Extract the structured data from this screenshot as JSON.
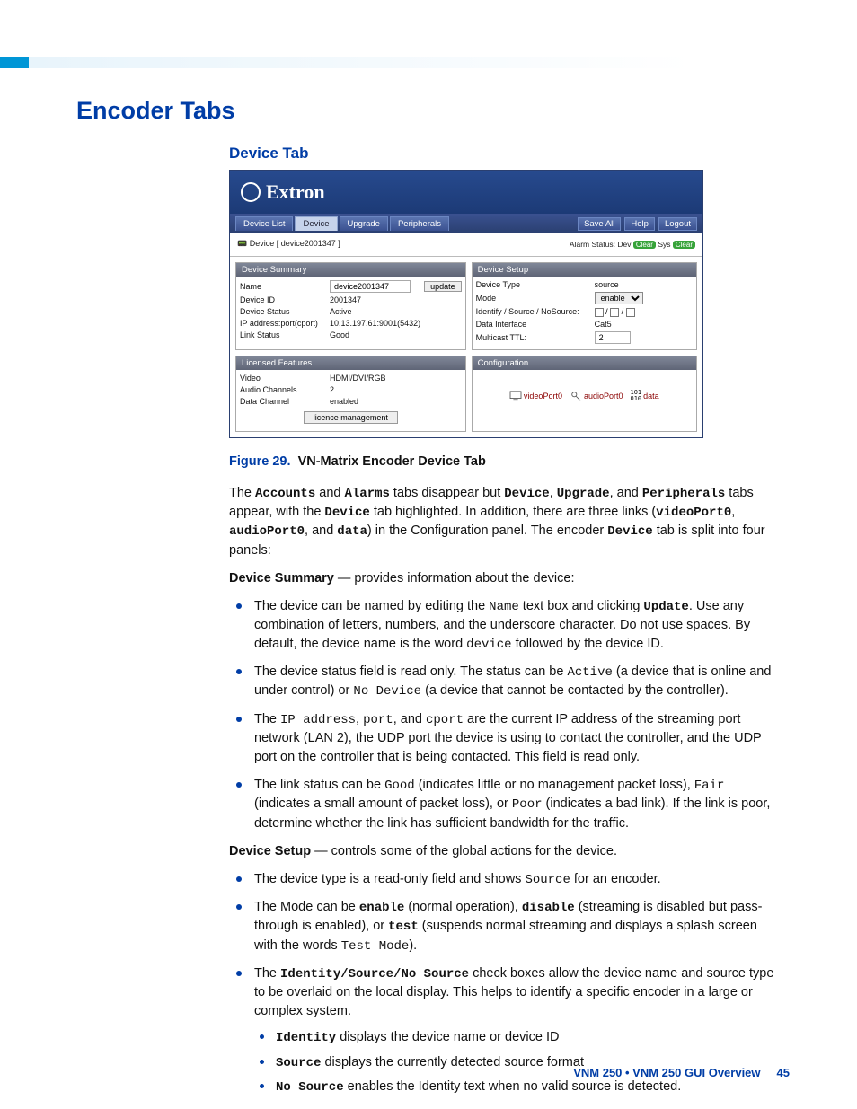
{
  "headings": {
    "section": "Encoder Tabs",
    "subsection": "Device Tab"
  },
  "screenshot": {
    "brand": "Extron",
    "tabs": {
      "device_list": "Device List",
      "device": "Device",
      "upgrade": "Upgrade",
      "peripherals": "Peripherals"
    },
    "top_buttons": {
      "save_all": "Save All",
      "help": "Help",
      "logout": "Logout"
    },
    "breadcrumb": "Device [ device2001347 ]",
    "alarm": {
      "label": "Alarm Status:",
      "dev": "Dev",
      "sys": "Sys",
      "clear": "Clear"
    },
    "panels": {
      "summary_head": "Device Summary",
      "setup_head": "Device Setup",
      "licensed_head": "Licensed Features",
      "config_head": "Configuration"
    },
    "summary": {
      "name_k": "Name",
      "name_v": "device2001347",
      "update": "update",
      "devid_k": "Device ID",
      "devid_v": "2001347",
      "status_k": "Device Status",
      "status_v": "Active",
      "ip_k": "IP address:port(cport)",
      "ip_v": "10.13.197.61:9001(5432)",
      "link_k": "Link Status",
      "link_v": "Good"
    },
    "setup": {
      "type_k": "Device Type",
      "type_v": "source",
      "mode_k": "Mode",
      "mode_v": "enable",
      "isn_k": "Identify / Source / NoSource:",
      "di_k": "Data Interface",
      "di_v": "Cat5",
      "ttl_k": "Multicast TTL:",
      "ttl_v": "2"
    },
    "licensed": {
      "video_k": "Video",
      "video_v": "HDMI/DVI/RGB",
      "audio_k": "Audio Channels",
      "audio_v": "2",
      "data_k": "Data Channel",
      "data_v": "enabled",
      "lic_btn": "licence management"
    },
    "config_links": {
      "video": "videoPort0",
      "audio": "audioPort0",
      "data": "data",
      "data_icon": "101\n010"
    }
  },
  "figure": {
    "label": "Figure 29.",
    "title": "VN-Matrix Encoder Device Tab"
  },
  "para1": {
    "t1": "The ",
    "accounts": "Accounts",
    "t2": " and ",
    "alarms": "Alarms",
    "t3": " tabs disappear but ",
    "device": "Device",
    "t4": ", ",
    "upgrade": "Upgrade",
    "t5": ", and ",
    "peripherals": "Peripherals",
    "t6": " tabs appear, with the ",
    "device2": "Device",
    "t7": " tab highlighted. In addition, there are three links (",
    "vp": "videoPort0",
    "t8": ", ",
    "ap": "audioPort0",
    "t9": ", and ",
    "data": "data",
    "t10": ") in the Configuration panel. The encoder ",
    "device3": "Device",
    "t11": " tab is split into four panels:"
  },
  "ds_intro": {
    "head": "Device Summary",
    "dash": " — provides information about the device:"
  },
  "ds_list": {
    "b1a": "The device can be named by editing the ",
    "b1_name": "Name",
    "b1b": " text box and clicking ",
    "b1_update": "Update",
    "b1c": ". Use any combination of letters, numbers, and the underscore character. Do not use spaces. By default, the device name is the word ",
    "b1_device": "device",
    "b1d": " followed by the device ID.",
    "b2a": "The device status field is read only. The status can be ",
    "b2_active": "Active",
    "b2b": " (a device that is online and under control) or ",
    "b2_nodev": "No Device",
    "b2c": " (a device that cannot be contacted by the controller).",
    "b3a": "The ",
    "b3_ip": "IP address",
    "b3b": ", ",
    "b3_port": "port",
    "b3c": ", and ",
    "b3_cport": "cport",
    "b3d": " are the current IP address of the streaming port network (LAN 2), the UDP port the device is using to contact the controller, and the UDP port on the controller that is being contacted. This field is read only.",
    "b4a": "The link status can be ",
    "b4_good": "Good",
    "b4b": " (indicates little or no management packet loss), ",
    "b4_fair": "Fair",
    "b4c": " (indicates a small amount of packet loss), or ",
    "b4_poor": "Poor",
    "b4d": " (indicates a bad link). If the link is poor, determine whether the link has sufficient bandwidth for the traffic."
  },
  "setup_intro": {
    "head": "Device Setup",
    "dash": " — controls some of the global actions for the device."
  },
  "setup_list": {
    "b1a": "The device type is a read-only field and shows ",
    "b1_source": "Source",
    "b1b": " for an encoder.",
    "b2a": "The Mode can be ",
    "b2_enable": "enable",
    "b2b": " (normal operation), ",
    "b2_disable": "disable",
    "b2c": " (streaming is disabled but pass-through is enabled), or ",
    "b2_test": "test",
    "b2d": " (suspends normal streaming and displays a splash screen with the words ",
    "b2_tm": "Test Mode",
    "b2e": ").",
    "b3a": "The ",
    "b3_isn": "Identity/Source/No Source",
    "b3b": " check boxes allow the device name and source type to be overlaid on the local display. This helps to identify a specific encoder in a large or complex system.",
    "s1_head": "Identity",
    "s1_t": " displays the device name or device ID",
    "s2_head": "Source",
    "s2_t": " displays the currently detected source format",
    "s3_head": "No Source",
    "s3_t": " enables the Identity text when no valid source is detected."
  },
  "footer": {
    "text": "VNM 250 • VNM 250 GUI Overview",
    "page": "45"
  }
}
